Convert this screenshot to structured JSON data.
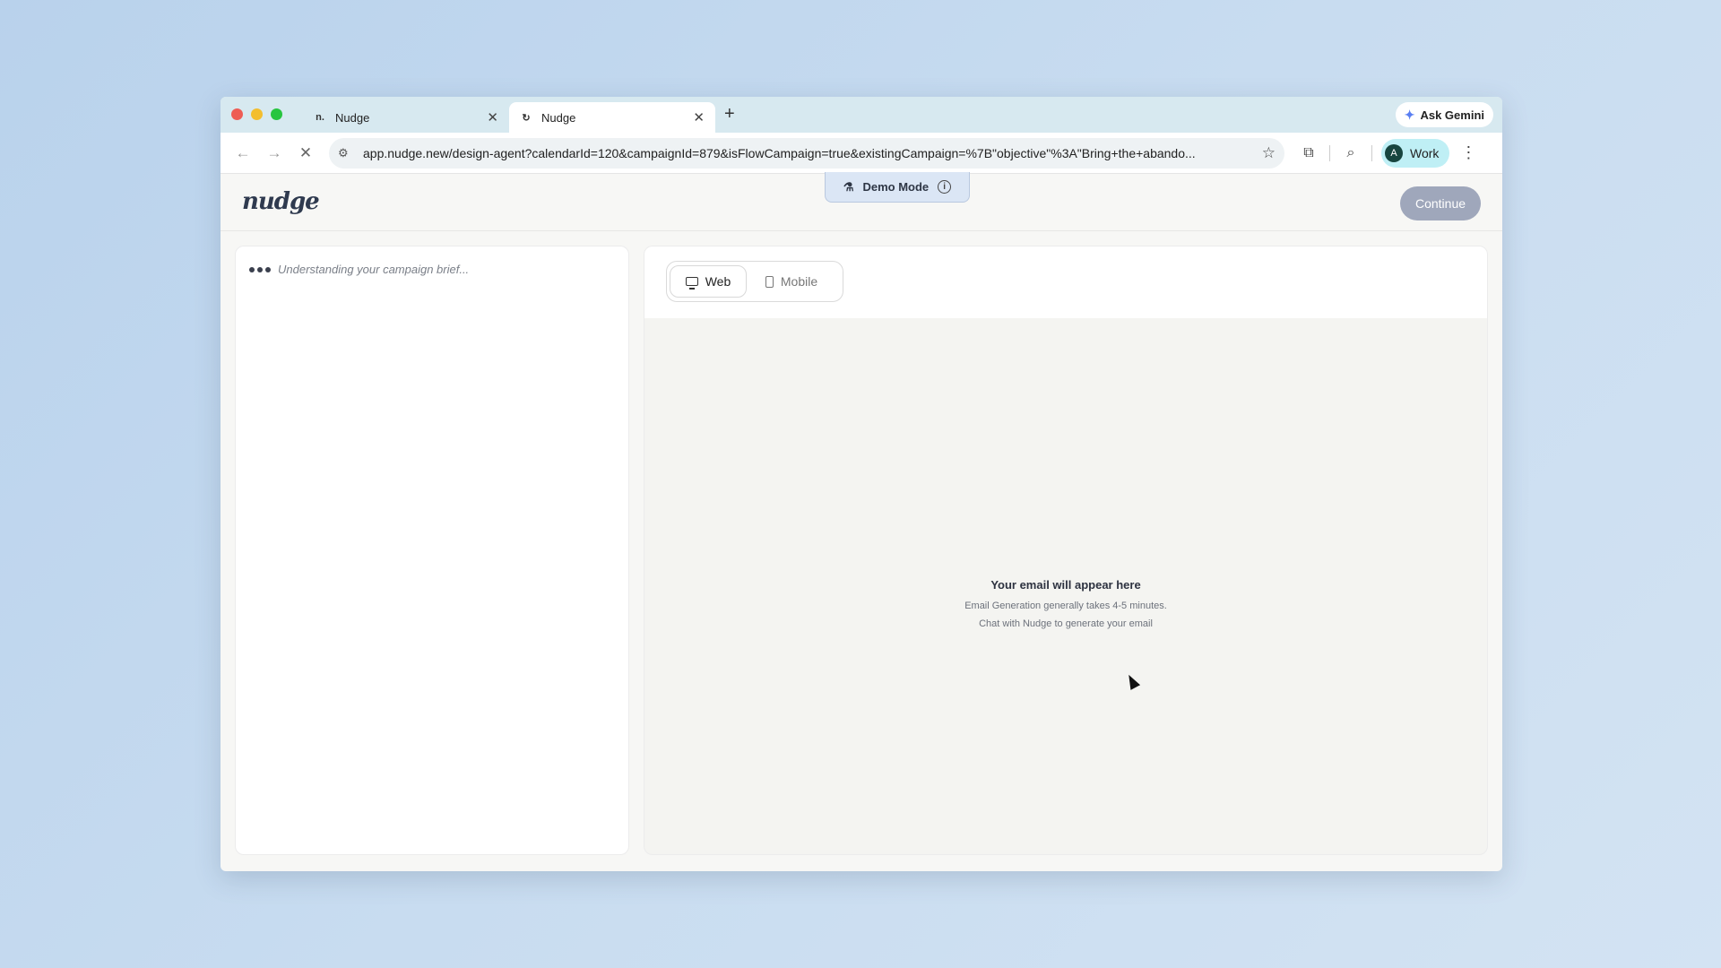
{
  "browser": {
    "tabs": [
      {
        "title": "Nudge",
        "favicon": "n."
      },
      {
        "title": "Nudge",
        "favicon": "↻"
      }
    ],
    "new_tab_label": "+",
    "ask_gemini": "Ask Gemini",
    "url_host": "app.nudge.new",
    "url_path": "/design-agent?calendarId=120&campaignId=879&isFlowCampaign=true&existingCampaign=%7B\"objective\"%3A\"Bring+the+abando...",
    "profile_initial": "A",
    "profile_label": "Work"
  },
  "app": {
    "logo": "nudge",
    "demo_mode": "Demo Mode",
    "continue_label": "Continue",
    "chat_status": "Understanding your campaign brief...",
    "preview_tabs": {
      "web": "Web",
      "mobile": "Mobile"
    },
    "empty_state": {
      "title": "Your email will appear here",
      "line1": "Email Generation generally takes 4-5 minutes.",
      "line2": "Chat with Nudge to generate your email"
    }
  }
}
